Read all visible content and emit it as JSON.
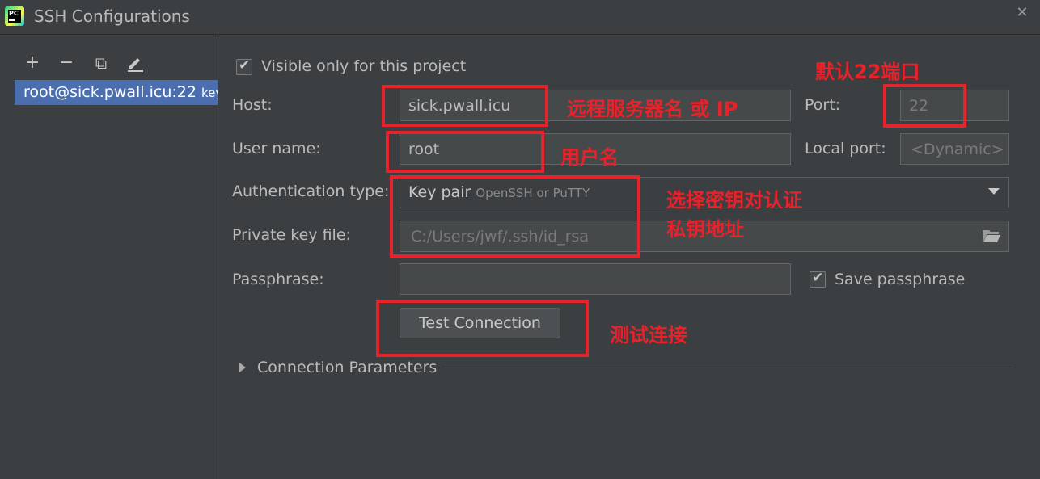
{
  "window": {
    "title": "SSH Configurations",
    "logo_text": "PC"
  },
  "toolbar": {
    "add": "+",
    "remove": "−",
    "copy": "⧉",
    "edit": "✎"
  },
  "list": {
    "items": [
      {
        "label": "root@sick.pwall.icu:22",
        "suffix": "key"
      }
    ]
  },
  "form": {
    "visible_only": {
      "label": "Visible only for this project",
      "checked": true
    },
    "host": {
      "label": "Host:",
      "value": "sick.pwall.icu"
    },
    "port": {
      "label": "Port:",
      "value": "22"
    },
    "username": {
      "label": "User name:",
      "value": "root"
    },
    "local_port": {
      "label": "Local port:",
      "value": "<Dynamic>"
    },
    "auth_type": {
      "label": "Authentication type:",
      "value": "Key pair",
      "hint": "OpenSSH or PuTTY"
    },
    "private_key": {
      "label": "Private key file:",
      "value": "C:/Users/jwf/.ssh/id_rsa"
    },
    "passphrase": {
      "label": "Passphrase:",
      "value": ""
    },
    "save_passphrase": {
      "label": "Save passphrase",
      "checked": true
    },
    "test_button": "Test Connection",
    "connection_params": "Connection Parameters"
  },
  "annotations": {
    "host_note": "远程服务器名 或 IP",
    "port_note": "默认22端口",
    "user_note": "用户名",
    "auth_note": "选择密钥对认证",
    "key_note": "私钥地址",
    "test_note": "测试连接"
  },
  "colors": {
    "annotation": "#e8222a",
    "selection": "#4b6eaf",
    "background": "#3c3f41"
  },
  "icons": [
    "pycharm-icon",
    "close-icon",
    "add-icon",
    "remove-icon",
    "copy-icon",
    "edit-icon",
    "checkbox-icon",
    "chevron-down-icon",
    "folder-icon",
    "expand-triangle-icon"
  ]
}
